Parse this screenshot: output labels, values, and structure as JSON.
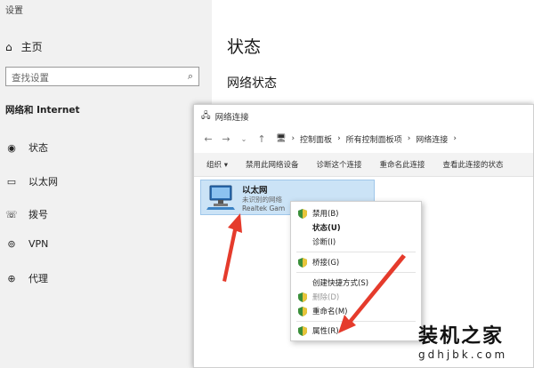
{
  "settings": {
    "window_title": "设置",
    "home_label": "主页",
    "search_placeholder": "查找设置",
    "section_title": "网络和 Internet",
    "nav": [
      {
        "label": "状态",
        "icon": "globe-icon"
      },
      {
        "label": "以太网",
        "icon": "monitor-icon"
      },
      {
        "label": "拨号",
        "icon": "phone-icon"
      },
      {
        "label": "VPN",
        "icon": "vpn-icon"
      },
      {
        "label": "代理",
        "icon": "globe-icon"
      }
    ],
    "main_title": "状态",
    "main_subtitle": "网络状态"
  },
  "net": {
    "title": "网络连接",
    "breadcrumbs": [
      "控制面板",
      "所有控制面板项",
      "网络连接"
    ],
    "toolbar": [
      "组织 ▾",
      "禁用此网络设备",
      "诊断这个连接",
      "重命名此连接",
      "查看此连接的状态"
    ],
    "adapter": {
      "name": "以太网",
      "status": "未识别的网络",
      "device": "Realtek Gam"
    },
    "menu": [
      {
        "label": "禁用(B)",
        "shield": true,
        "bold": false
      },
      {
        "label": "状态(U)",
        "shield": false,
        "bold": true
      },
      {
        "label": "诊断(I)",
        "shield": false,
        "bold": false
      },
      {
        "label": "桥接(G)",
        "shield": true,
        "bold": false
      },
      {
        "label": "创建快捷方式(S)",
        "shield": false,
        "bold": false
      },
      {
        "label": "删除(D)",
        "shield": true,
        "bold": false
      },
      {
        "label": "重命名(M)",
        "shield": true,
        "bold": false
      },
      {
        "label": "属性(R)",
        "shield": true,
        "bold": false
      }
    ]
  },
  "watermark": {
    "name": "装机之家",
    "url": "gdhjbk.com"
  },
  "colors": {
    "arrow": "#e53b2c",
    "selection": "#cbe3f6"
  }
}
